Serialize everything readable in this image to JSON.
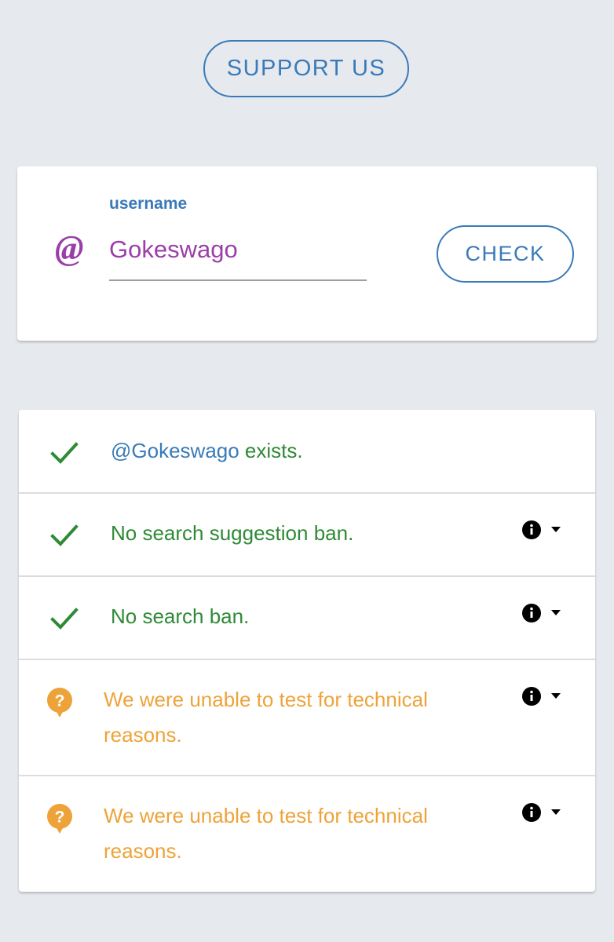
{
  "header": {
    "support_label": "SUPPORT US"
  },
  "search": {
    "field_label": "username",
    "value": "Gokeswago",
    "at_symbol": "@",
    "check_label": "CHECK"
  },
  "results": [
    {
      "status": "ok",
      "icon": "check-icon",
      "handle": "@Gokeswago",
      "text": " exists.",
      "has_info": false
    },
    {
      "status": "ok",
      "icon": "check-icon",
      "text": "No search suggestion ban.",
      "has_info": true
    },
    {
      "status": "ok",
      "icon": "check-icon",
      "text": "No search ban.",
      "has_info": true
    },
    {
      "status": "unknown",
      "icon": "question-bubble-icon",
      "text": "We were unable to test for technical reasons.",
      "has_info": true
    },
    {
      "status": "unknown",
      "icon": "question-bubble-icon",
      "text": "We were unable to test for technical reasons.",
      "has_info": true
    }
  ],
  "colors": {
    "background": "#e6e9ee",
    "accent": "#3a7ab8",
    "username": "#9b3fa8",
    "ok": "#2e8a35",
    "warn": "#eda33a"
  }
}
